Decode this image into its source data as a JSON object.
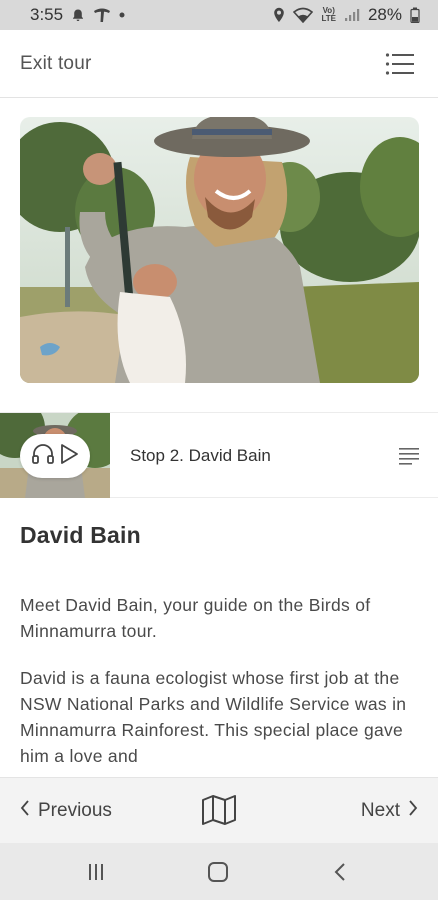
{
  "status_bar": {
    "time": "3:55",
    "battery": "28%",
    "network_top": "Vo)",
    "network_bottom": "LTE",
    "icons": [
      "alarm-icon",
      "carrier-logo-icon",
      "notification-dot-icon",
      "location-icon",
      "wifi-icon",
      "signal-icon",
      "battery-icon"
    ]
  },
  "header": {
    "exit_label": "Exit tour",
    "menu_icon": "list-menu-icon"
  },
  "hero": {
    "image_subject": "photo"
  },
  "stop": {
    "title": "Stop 2. David Bain",
    "audio_icon": "headphones-play-icon",
    "list_icon": "transcript-list-icon"
  },
  "content": {
    "heading": "David Bain",
    "paragraph1": "Meet David Bain, your guide on the Birds of Minnamurra tour.",
    "paragraph2": "David is a fauna ecologist whose first job at the NSW National Parks and Wildlife Service was in Minnamurra Rainforest. This special place gave him a love and"
  },
  "footer": {
    "previous_label": "Previous",
    "next_label": "Next",
    "map_icon": "map-icon"
  },
  "system_nav": {
    "icons": [
      "recents-icon",
      "home-icon",
      "back-icon"
    ]
  },
  "colors": {
    "status_bg": "#d9d9d9",
    "footer_bg": "#f3f3f3",
    "system_nav_bg": "#e9e9e9",
    "text": "#333333"
  }
}
